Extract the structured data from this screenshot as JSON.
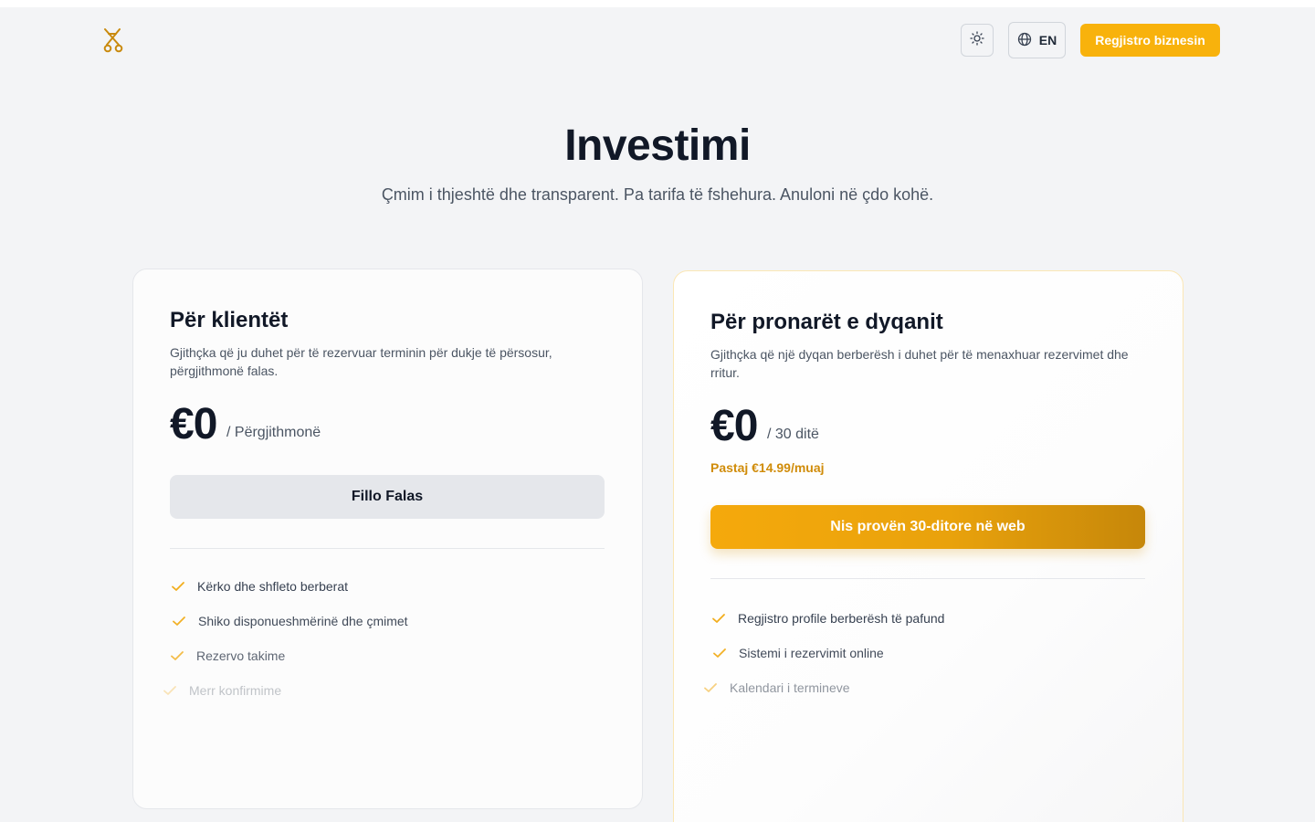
{
  "header": {
    "theme_toggle_icon": "sun-icon",
    "language_icon": "globe-icon",
    "language": "EN",
    "register_label": "Regjistro biznesin",
    "accent": "#f8b20c"
  },
  "hero": {
    "title": "Investimi",
    "subtitle": "Çmim i thjeshtë dhe transparent. Pa tarifa të fshehura. Anuloni në çdo kohë."
  },
  "plans": [
    {
      "title": "Për klientët",
      "description": "Gjithçka që ju duhet për të rezervuar terminin për dukje të përsosur, përgjithmonë falas.",
      "price": "€0",
      "period": "/ Përgjithmonë",
      "cta": "Fillo Falas",
      "features": [
        "Kërko dhe shfleto berberat",
        "Shiko disponueshmërinë dhe çmimet",
        "Rezervo takime",
        "Merr konfirmime"
      ]
    },
    {
      "title": "Për pronarët e dyqanit",
      "description": "Gjithçka që një dyqan berberësh i duhet për të menaxhuar rezervimet dhe rritur.",
      "price": "€0",
      "period": "/ 30 ditë",
      "after_trial": "Pastaj €14.99/muaj",
      "cta": "Nis provën 30-ditore në web",
      "features": [
        "Regjistro profile berberësh të pafund",
        "Sistemi i rezervimit online",
        "Kalendari i termineve"
      ]
    }
  ]
}
